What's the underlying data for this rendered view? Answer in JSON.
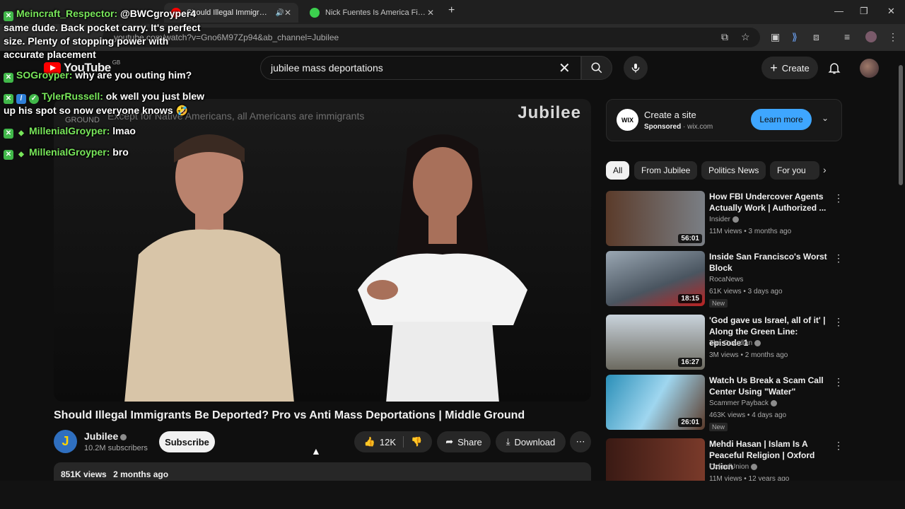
{
  "tabs": [
    {
      "label": "Should Illegal Immigrants Be Deported?",
      "active": true
    },
    {
      "label": "Nick Fuentes Is America First. T",
      "active": false
    }
  ],
  "address": {
    "url": "youtube.com/watch?v=Gno6M97Zp94&ab_channel=Jubilee"
  },
  "header": {
    "logo_word": "YouTube",
    "logo_region": "GB",
    "search_value": "jubilee mass deportations",
    "create_label": "Create"
  },
  "video": {
    "caption": "Except for Native Americans, all Americans are immigrants",
    "brand": "Jubilee",
    "ground_label": "GROUND",
    "title": "Should Illegal Immigrants Be Deported? Pro vs Anti Mass Deportations | Middle Ground"
  },
  "channel": {
    "initial": "J",
    "name": "Jubilee",
    "subscribers": "10.2M subscribers",
    "subscribe_label": "Subscribe"
  },
  "actions": {
    "likes": "12K",
    "share_label": "Share",
    "download_label": "Download"
  },
  "description": {
    "views": "851K views",
    "date": "2 months ago"
  },
  "ad": {
    "logo": "WIX",
    "title": "Create a site",
    "sponsored": "Sponsored",
    "domain": "wix.com",
    "cta": "Learn more"
  },
  "chips": [
    "All",
    "From Jubilee",
    "Politics News",
    "For you"
  ],
  "recommendations": [
    {
      "title": "How FBI Undercover Agents Actually Work | Authorized ...",
      "channel": "Insider",
      "meta": "11M views • 3 months ago",
      "duration": "56:01",
      "new": false
    },
    {
      "title": "Inside San Francisco's Worst Block",
      "channel": "RocaNews",
      "meta": "61K views • 3 days ago",
      "duration": "18:15",
      "new": true
    },
    {
      "title": "'God gave us Israel, all of it' | Along the Green Line: episode 1",
      "channel": "The Guardian",
      "meta": "3M views • 2 months ago",
      "duration": "16:27",
      "new": false
    },
    {
      "title": "Watch Us Break a Scam Call Center Using \"Water\"",
      "channel": "Scammer Payback",
      "meta": "463K views • 4 days ago",
      "duration": "26:01",
      "new": true
    },
    {
      "title": "Mehdi Hasan | Islam Is A Peaceful Religion | Oxford Union",
      "channel": "OxfordUnion",
      "meta": "11M views • 12 years ago",
      "duration": "",
      "new": false
    }
  ],
  "new_label": "New",
  "chat": [
    {
      "user": "Meincraft_Respector:",
      "text": "@BWCgroyper4 same dude. Back pocket carry. It's perfect size. Plenty of stopping power with accurate placement"
    },
    {
      "user": "SOGroyper:",
      "text": "why are you outing him?"
    },
    {
      "user": "TylerRussell:",
      "text": "ok well you just blew up his spot so now everyone knows 🤣"
    },
    {
      "user": "MillenialGroyper:",
      "text": "lmao"
    },
    {
      "user": "MillenialGroyper:",
      "text": "bro"
    }
  ],
  "colors": {
    "accent": "#3ea6ff",
    "brand_red": "#ff0000",
    "chat_user": "#78e65a"
  }
}
